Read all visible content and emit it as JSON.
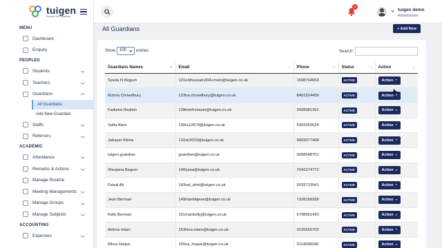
{
  "brand": {
    "name": "tuigen",
    "tagline": "Elevate Your Business"
  },
  "sidebar": {
    "sections": [
      {
        "title": "MENU",
        "items": [
          {
            "label": "Dashboard"
          },
          {
            "label": "Enquiry"
          }
        ]
      },
      {
        "title": "PEOPLES",
        "items": [
          {
            "label": "Students",
            "chevron": true
          },
          {
            "label": "Teachers",
            "chevron": true
          },
          {
            "label": "Guardians",
            "chevron": true,
            "open": true,
            "sub": [
              {
                "label": "All Guardians",
                "active": true
              },
              {
                "label": "Add New Guardian"
              }
            ]
          },
          {
            "label": "Staffs",
            "chevron": true
          },
          {
            "label": "Referrers",
            "chevron": true
          }
        ]
      },
      {
        "title": "ACADEMIC",
        "items": [
          {
            "label": "Attendance",
            "chevron": true
          },
          {
            "label": "Remarks & Actions",
            "chevron": true
          },
          {
            "label": "Manage Routine"
          },
          {
            "label": "Meeting Managements",
            "chevron": true
          },
          {
            "label": "Manage Groups",
            "chevron": true
          },
          {
            "label": "Manage Subjects",
            "chevron": true
          }
        ]
      },
      {
        "title": "ACCOUNTING",
        "items": [
          {
            "label": "Expenses",
            "chevron": true
          }
        ]
      }
    ]
  },
  "topbar": {
    "notification_count": "1",
    "user_name": "tuigen demo",
    "user_role": "Administrator"
  },
  "page": {
    "title": "All Guardians",
    "add_button": "+ Add New"
  },
  "table_controls": {
    "show_label": "Show",
    "page_size": "100",
    "entries_label": "entries",
    "search_label": "Search:"
  },
  "table": {
    "columns": [
      "Guardians Names",
      "Email",
      "Phone",
      "Status",
      "Action"
    ],
    "action_label": "Action",
    "rows": [
      {
        "name": "Syeda N Begum",
        "email": "121edihussain304+mom@tuigen.co.uk",
        "phone": "1508764653",
        "status": "ACTIVE"
      },
      {
        "name": "Rubna Chowdhury",
        "email": "123na.chowdhury@tuigen.co.uk",
        "phone": "8451524459",
        "status": "ACTIVE"
      },
      {
        "name": "Faduma Ibrahim",
        "email": "128merhossain@tuigen.co.uk",
        "phone": "3428981391",
        "status": "ACTIVE"
      },
      {
        "name": "Safia Alam",
        "email": "130ia12879@tuigen.co.uk",
        "phone": "5303363534",
        "status": "ACTIVE"
      },
      {
        "name": "Jubayer Kibria",
        "email": "132zk2010@tuigen.co.uk",
        "phone": "9903077408",
        "status": "ACTIVE"
      },
      {
        "name": "tuigen guardian",
        "email": "guardian@tuigen.co.uk",
        "phone": "0058548701",
        "status": "ACTIVE"
      },
      {
        "name": "Shurjana Begum",
        "email": "140rjana@tuigen.co.uk",
        "phone": "7642374772",
        "status": "ACTIVE"
      },
      {
        "name": "Faisal Ali",
        "email": "143sal_elmi@tuigen.co.uk",
        "phone": "0033713541",
        "status": "ACTIVE"
      },
      {
        "name": "Jean Berman",
        "email": "149manbbjean@tuigen.co.uk",
        "phone": "7328189338",
        "status": "ACTIVE"
      },
      {
        "name": "Kelly Berman",
        "email": "151mankelly@tuigen.co.uk",
        "phone": "6798961420",
        "status": "ACTIVE"
      },
      {
        "name": "Aklima Islam",
        "email": "153lima.islam@tuigen.co.uk",
        "phone": "3226565703",
        "status": "ACTIVE"
      },
      {
        "name": "Mirza Hoque",
        "email": "155za_hoque@tuigen.co.uk",
        "phone": "0114098340",
        "status": "ACTIVE"
      }
    ]
  }
}
